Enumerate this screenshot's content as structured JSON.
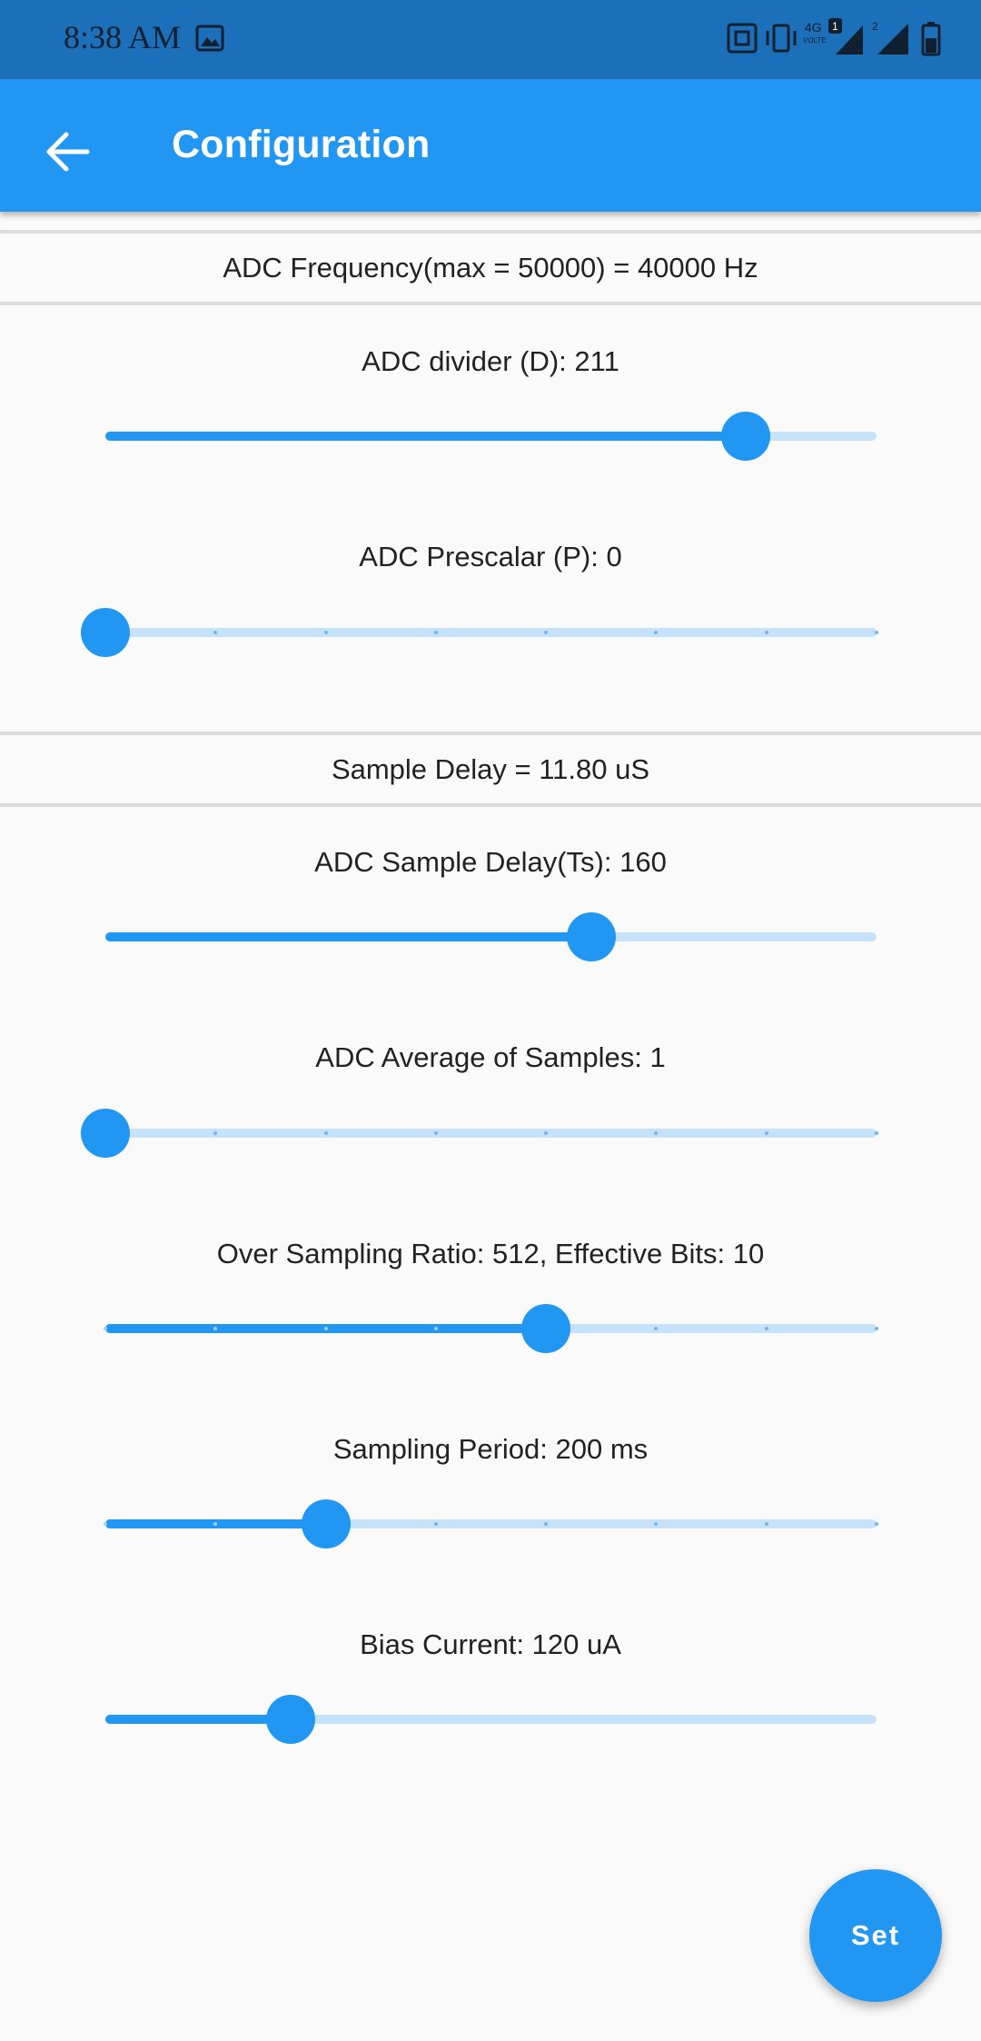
{
  "status_bar": {
    "time": "8:38 AM",
    "network_label": "4G",
    "volte_label": "VOLTE",
    "sim1_badge": "1",
    "sim2_badge": "2"
  },
  "app_bar": {
    "title": "Configuration",
    "back_icon": "arrow-left-icon"
  },
  "bands": {
    "adc_frequency": "ADC Frequency(max = 50000) = 40000 Hz",
    "sample_delay": "Sample Delay = 11.80 uS"
  },
  "sliders": [
    {
      "label": "ADC divider (D): 211",
      "fraction": 0.83,
      "divisions": 0
    },
    {
      "label": "ADC Prescalar (P): 0",
      "fraction": 0.0,
      "divisions": 7
    },
    {
      "label": "ADC Sample Delay(Ts): 160",
      "fraction": 0.63,
      "divisions": 0
    },
    {
      "label": "ADC Average of Samples: 1",
      "fraction": 0.0,
      "divisions": 7
    },
    {
      "label": "Over Sampling Ratio: 512, Effective Bits: 10",
      "fraction": 0.5714,
      "divisions": 7
    },
    {
      "label": "Sampling Period: 200 ms",
      "fraction": 0.2857,
      "divisions": 7
    },
    {
      "label": "Bias Current: 120 uA",
      "fraction": 0.24,
      "divisions": 0
    }
  ],
  "fab": {
    "label": "Set"
  },
  "colors": {
    "primary": "#2196f3",
    "status_bar": "#1c6fb9",
    "inactive_track": "#c6e2fa"
  }
}
